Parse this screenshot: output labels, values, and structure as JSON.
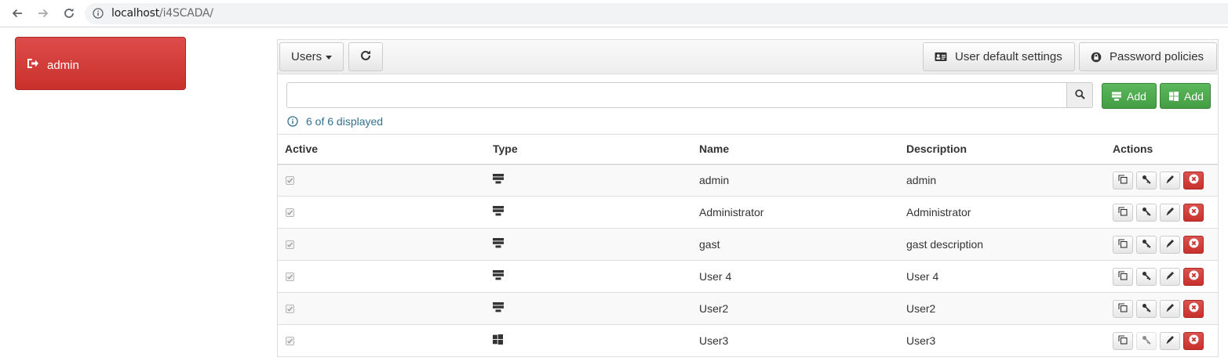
{
  "browser": {
    "url_host": "localhost",
    "url_path": "/i4SCADA/"
  },
  "sidebar": {
    "logout_label": "admin"
  },
  "toolbar": {
    "users_label": "Users",
    "user_default_settings_label": "User default settings",
    "password_policies_label": "Password policies"
  },
  "search": {
    "value": "",
    "placeholder": ""
  },
  "add_buttons": {
    "add_user_label": "Add",
    "add_windows_user_label": "Add"
  },
  "count_text": "6 of 6 displayed",
  "table": {
    "headers": {
      "active": "Active",
      "type": "Type",
      "name": "Name",
      "description": "Description",
      "actions": "Actions"
    },
    "rows": [
      {
        "active": true,
        "type": "server-icon",
        "name": "admin",
        "description": "admin"
      },
      {
        "active": true,
        "type": "server-icon",
        "name": "Administrator",
        "description": "Administrator"
      },
      {
        "active": true,
        "type": "server-icon",
        "name": "gast",
        "description": "gast description"
      },
      {
        "active": true,
        "type": "server-icon",
        "name": "User 4",
        "description": "User 4"
      },
      {
        "active": true,
        "type": "server-icon",
        "name": "User2",
        "description": "User2"
      },
      {
        "active": true,
        "type": "windows-icon",
        "name": "User3",
        "description": "User3"
      }
    ]
  },
  "colors": {
    "danger": "#c9302c",
    "success": "#449d44",
    "info_text": "#31708f"
  }
}
